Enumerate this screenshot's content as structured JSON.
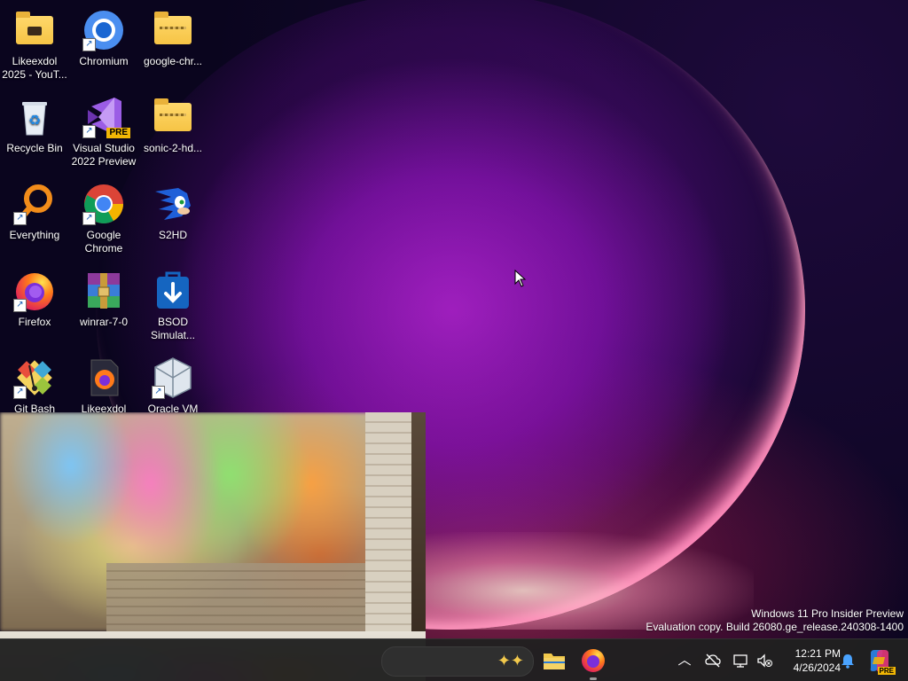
{
  "desktop": {
    "icons": [
      {
        "label": "Likeexdol\n2025 - YouT...",
        "icon": "folder-icon"
      },
      {
        "label": "Chromium",
        "icon": "chromium-icon"
      },
      {
        "label": "google-chr...",
        "icon": "zip-folder-icon"
      },
      {
        "label": "Recycle Bin",
        "icon": "recycle-bin-icon"
      },
      {
        "label": "Visual Studio\n2022 Preview",
        "icon": "visual-studio-icon",
        "badge": "PRE"
      },
      {
        "label": "sonic-2-hd...",
        "icon": "zip-folder-icon"
      },
      {
        "label": "Everything",
        "icon": "search-magnifier-icon"
      },
      {
        "label": "Google\nChrome",
        "icon": "chrome-icon"
      },
      {
        "label": "S2HD",
        "icon": "sonic-icon"
      },
      {
        "label": "Firefox",
        "icon": "firefox-icon"
      },
      {
        "label": "winrar-7-0",
        "icon": "winrar-icon"
      },
      {
        "label": "BSOD\nSimulat...",
        "icon": "download-bag-icon"
      },
      {
        "label": "Git Bash",
        "icon": "git-icon"
      },
      {
        "label": "Likeexdol",
        "icon": "firefox-file-icon"
      },
      {
        "label": "Oracle VM",
        "icon": "virtualbox-icon"
      }
    ]
  },
  "watermark": {
    "line1": "Windows 11 Pro Insider Preview",
    "line2": "Evaluation copy. Build 26080.ge_release.240308-1400"
  },
  "taskbar": {
    "pinned": [
      {
        "name": "file-explorer",
        "icon": "folder-icon"
      },
      {
        "name": "firefox",
        "icon": "firefox-icon"
      }
    ],
    "tray": [
      "chevron-up-icon",
      "cloud-off-icon",
      "display-icon",
      "volume-muted-icon"
    ],
    "clock": {
      "time": "12:21 PM",
      "date": "4/26/2024"
    },
    "copilot_badge": "PRE"
  },
  "colors": {
    "taskbar_bg": "#202020",
    "accent_pink": "#ff4fa0",
    "accent_purple": "#9a1ec8"
  }
}
